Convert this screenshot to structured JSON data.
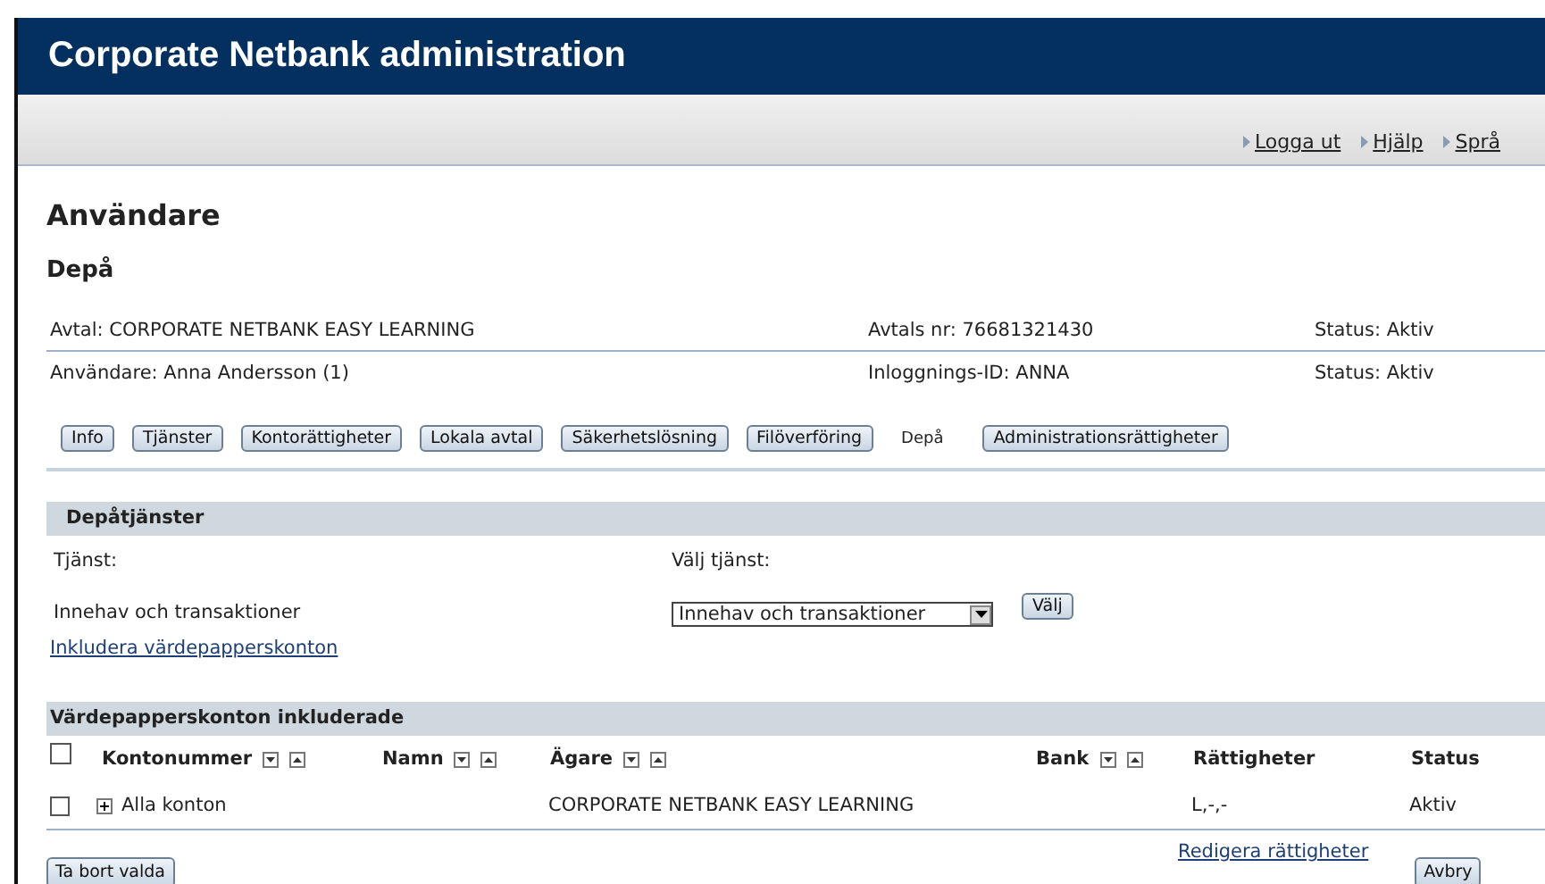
{
  "window": {
    "title": "Corporate Netbank administration"
  },
  "top_links": [
    {
      "label": "Logga ut"
    },
    {
      "label": "Hjälp"
    },
    {
      "label": "Språ"
    }
  ],
  "page_title": "Användare",
  "section_title": "Depå",
  "info_rows": [
    {
      "cells": [
        "Avtal: CORPORATE NETBANK EASY LEARNING",
        "Avtals nr: 76681321430",
        "Status: Aktiv"
      ]
    },
    {
      "cells": [
        "Användare: Anna Andersson (1)",
        "Inloggnings-ID: ANNA",
        "Status: Aktiv"
      ]
    }
  ],
  "tabs": [
    {
      "label": "Info",
      "selected": false
    },
    {
      "label": "Tjänster",
      "selected": false
    },
    {
      "label": "Kontorättigheter",
      "selected": false
    },
    {
      "label": "Lokala avtal",
      "selected": false
    },
    {
      "label": "Säkerhetslösning",
      "selected": false
    },
    {
      "label": "Filöverföring",
      "selected": false
    },
    {
      "label": "Depå",
      "selected": true
    },
    {
      "label": "Administrationsrättigheter",
      "selected": false
    }
  ],
  "services": {
    "heading": "Depåtjänster",
    "service_label": "Tjänst:",
    "choose_label": "Välj tjänst:",
    "service_value": "Innehav och transaktioner",
    "select_value": "Innehav och transaktioner",
    "choose_button": "Välj",
    "link": "Inkludera värdepapperskonton"
  },
  "accounts": {
    "heading": "Värdepapperskonton inkluderade",
    "select_all_checked": false,
    "columns": [
      {
        "label": "Kontonummer",
        "kind": "sort"
      },
      {
        "label": "Namn",
        "kind": "sort"
      },
      {
        "label": "Ägare",
        "kind": "sort"
      },
      {
        "label": "Bank",
        "kind": "sort"
      },
      {
        "label": "Rättigheter",
        "kind": "plain"
      },
      {
        "label": "Status",
        "kind": "plain"
      }
    ],
    "rows": [
      {
        "checked": false,
        "account": "Alla konton",
        "owner": "CORPORATE NETBANK EASY LEARNING",
        "rights": "L,-,-",
        "status": "Aktiv"
      }
    ],
    "edit_link": "Redigera rättigheter",
    "delete_button": "Ta bort valda",
    "cancel_button": "Avbry"
  }
}
